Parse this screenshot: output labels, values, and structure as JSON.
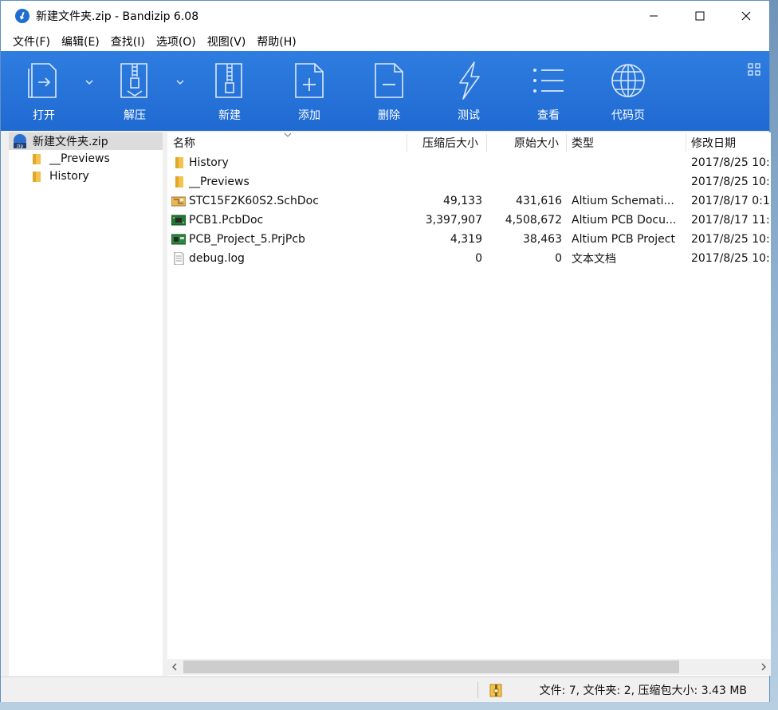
{
  "window": {
    "title": "新建文件夹.zip - Bandizip 6.08"
  },
  "menu": {
    "items": [
      "文件(F)",
      "编辑(E)",
      "查找(I)",
      "选项(O)",
      "视图(V)",
      "帮助(H)"
    ]
  },
  "toolbar": {
    "buttons": [
      {
        "label": "打开",
        "icon": "open-archive-icon"
      },
      {
        "label": "解压",
        "icon": "extract-icon"
      },
      {
        "label": "新建",
        "icon": "new-archive-icon"
      },
      {
        "label": "添加",
        "icon": "add-file-icon"
      },
      {
        "label": "删除",
        "icon": "delete-file-icon"
      },
      {
        "label": "测试",
        "icon": "test-icon"
      },
      {
        "label": "查看",
        "icon": "view-list-icon"
      },
      {
        "label": "代码页",
        "icon": "globe-icon"
      }
    ]
  },
  "tree": {
    "root": "新建文件夹.zip",
    "children": [
      "__Previews",
      "History"
    ]
  },
  "list": {
    "columns": [
      "名称",
      "压缩后大小",
      "原始大小",
      "类型",
      "修改日期"
    ],
    "rows": [
      {
        "name": "History",
        "compressed": "",
        "original": "",
        "type": "",
        "date": "2017/8/25 10:",
        "icon": "folder-icon"
      },
      {
        "name": "__Previews",
        "compressed": "",
        "original": "",
        "type": "",
        "date": "2017/8/25 10:",
        "icon": "folder-icon"
      },
      {
        "name": "STC15F2K60S2.SchDoc",
        "compressed": "49,133",
        "original": "431,616",
        "type": "Altium Schemati...",
        "date": "2017/8/17 0:1",
        "icon": "schematic-file-icon"
      },
      {
        "name": "PCB1.PcbDoc",
        "compressed": "3,397,907",
        "original": "4,508,672",
        "type": "Altium PCB Docu...",
        "date": "2017/8/17 11:",
        "icon": "pcb-file-icon"
      },
      {
        "name": "PCB_Project_5.PrjPcb",
        "compressed": "4,319",
        "original": "38,463",
        "type": "Altium PCB Project",
        "date": "2017/8/25 10:",
        "icon": "pcb-project-icon"
      },
      {
        "name": "debug.log",
        "compressed": "0",
        "original": "0",
        "type": "文本文档",
        "date": "2017/8/25 10:",
        "icon": "text-file-icon"
      }
    ]
  },
  "status": {
    "text": "文件: 7, 文件夹: 2, 压缩包大小: 3.43 MB"
  },
  "colors": {
    "toolbar": "#2874dc",
    "accent": "#1f6fd2",
    "folder": "#f3c34b"
  }
}
